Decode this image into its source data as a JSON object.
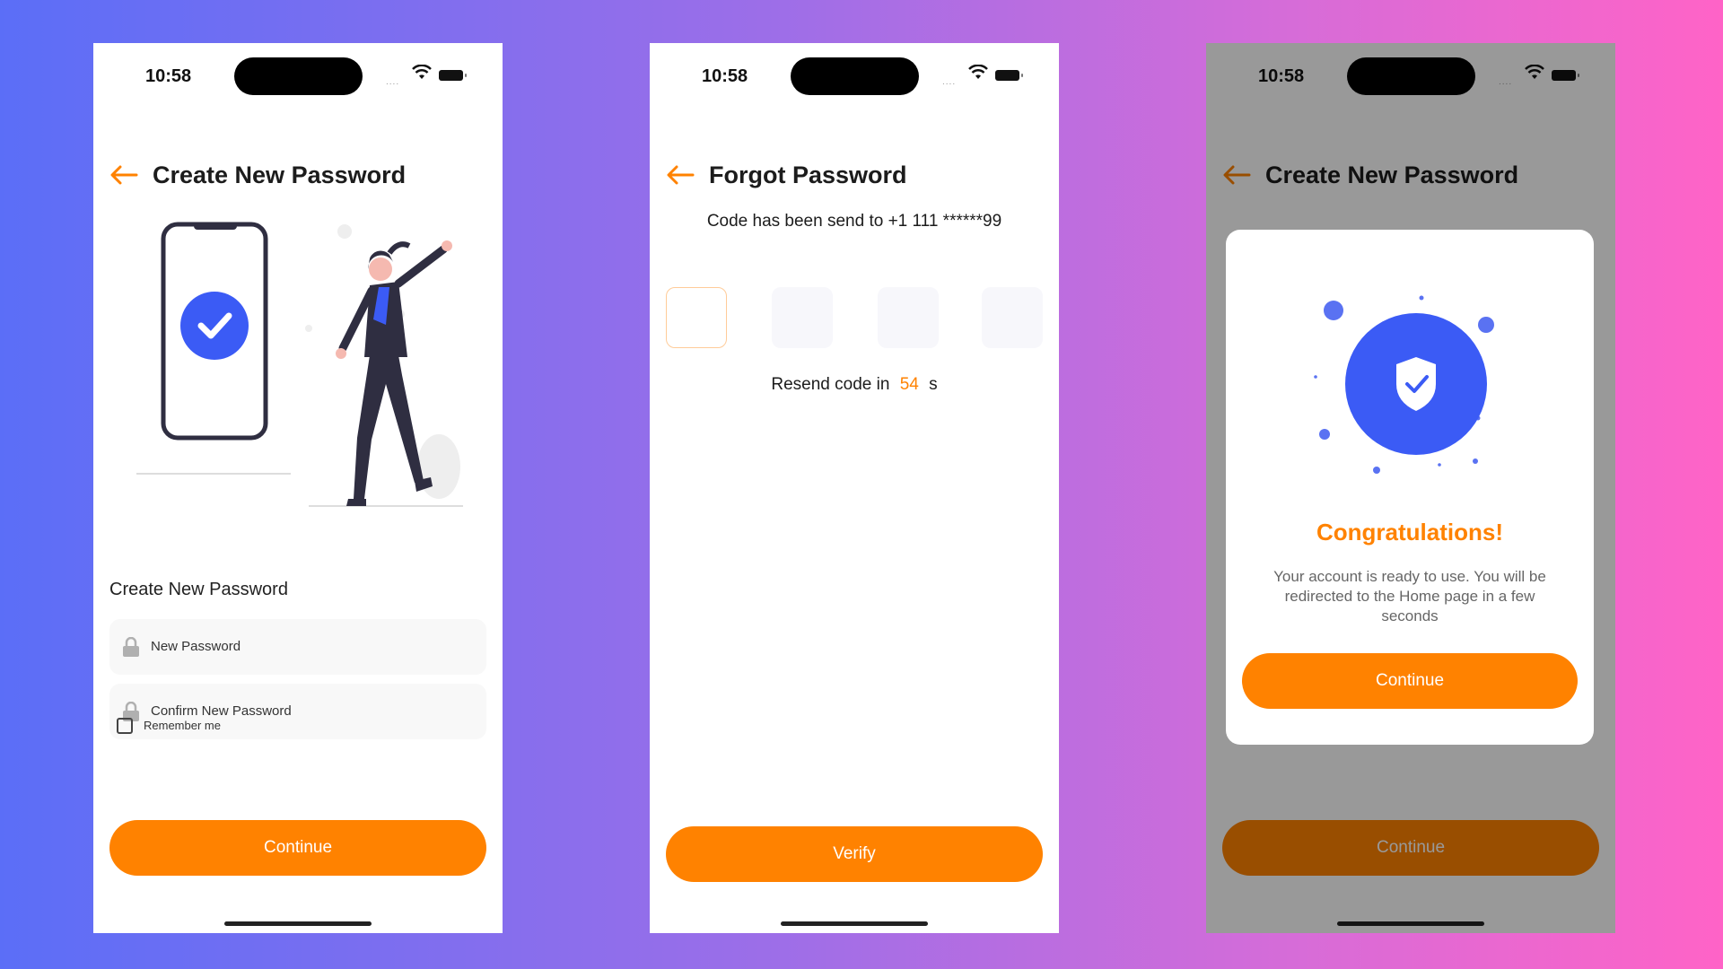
{
  "screens": [
    {
      "status": {
        "time": "10:58"
      },
      "header": {
        "title": "Create New Password"
      },
      "form": {
        "section_label": "Create New Password",
        "new_password_placeholder": "New Password",
        "confirm_password_placeholder": "Confirm New Password",
        "remember_label": "Remember me"
      },
      "continue_label": "Continue"
    },
    {
      "status": {
        "time": "10:58"
      },
      "header": {
        "title": "Forgot Password"
      },
      "code_info": "Code has been send to +1 111 ******99",
      "resend": {
        "prefix": "Resend code in",
        "seconds": "54",
        "suffix": "s"
      },
      "verify_label": "Verify"
    },
    {
      "status": {
        "time": "10:58"
      },
      "header": {
        "title": "Create New Password"
      },
      "modal": {
        "title": "Congratulations!",
        "message": "Your account is ready to use. You will be redirected to the Home page in a few seconds",
        "button_label": "Continue"
      },
      "continue_label": "Continue"
    }
  ],
  "colors": {
    "accent": "#ff8200",
    "primary_blue": "#3b5bf5"
  },
  "icons": [
    "back-arrow-icon",
    "lock-icon",
    "wifi-icon",
    "battery-icon",
    "checkmark-icon",
    "shield-check-icon"
  ]
}
